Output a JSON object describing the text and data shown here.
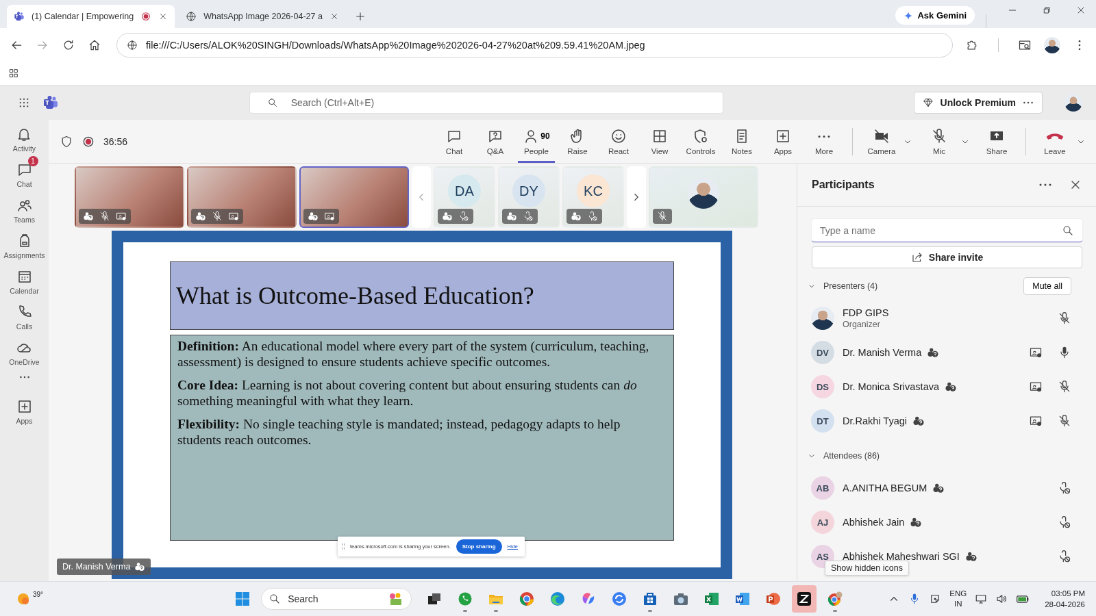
{
  "browser": {
    "tabs": [
      {
        "title": "(1) Calendar | Empowering",
        "recording": true,
        "selected": true
      },
      {
        "title": "WhatsApp Image 2026-04-27 a",
        "recording": false,
        "selected": false
      }
    ],
    "ask_gemini": "Ask Gemini",
    "url": "file:///C:/Users/ALOK%20SINGH/Downloads/WhatsApp%20Image%202026-04-27%20at%209.59.41%20AM.jpeg"
  },
  "header": {
    "search": {
      "placeholder": "Search (Ctrl+Alt+E)"
    },
    "premium": "Unlock Premium"
  },
  "rail": [
    {
      "kind": "activity",
      "label": "Activity"
    },
    {
      "kind": "chat",
      "label": "Chat",
      "badge": "1"
    },
    {
      "kind": "teams",
      "label": "Teams"
    },
    {
      "kind": "assignments",
      "label": "Assignments"
    },
    {
      "kind": "calendar",
      "label": "Calendar"
    },
    {
      "kind": "calls",
      "label": "Calls"
    },
    {
      "kind": "onedrive",
      "label": "OneDrive"
    },
    {
      "kind": "more"
    },
    {
      "kind": "apps",
      "label": "Apps"
    }
  ],
  "meeting": {
    "timer": "36:56",
    "recording": true,
    "actions": [
      {
        "kind": "chat",
        "label": "Chat",
        "selected": false
      },
      {
        "kind": "qa",
        "label": "Q&A",
        "selected": false
      },
      {
        "kind": "people",
        "label": "People",
        "count": "90",
        "selected": true
      },
      {
        "kind": "raise",
        "label": "Raise",
        "selected": false
      },
      {
        "kind": "react",
        "label": "React",
        "selected": false
      },
      {
        "kind": "view",
        "label": "View",
        "selected": false
      },
      {
        "kind": "controls",
        "label": "Controls",
        "selected": false
      },
      {
        "kind": "notes",
        "label": "Notes",
        "selected": false
      },
      {
        "kind": "apps",
        "label": "Apps",
        "selected": false
      },
      {
        "kind": "more",
        "label": "More",
        "selected": false
      }
    ],
    "devices": [
      {
        "kind": "camera",
        "label": "Camera",
        "caret": true
      },
      {
        "kind": "mic",
        "label": "Mic",
        "caret": true
      },
      {
        "kind": "share",
        "label": "Share",
        "caret": false
      },
      {
        "kind": "leave",
        "label": "Leave",
        "caret": true
      }
    ],
    "tiles": [
      {
        "kind": "video",
        "muted": true,
        "screen": true,
        "speaking": false
      },
      {
        "kind": "video",
        "muted": true,
        "screen": true,
        "speaking": false
      },
      {
        "kind": "video",
        "screen": true,
        "speaking": true
      },
      {
        "kind": "prev"
      },
      {
        "kind": "initials",
        "initials": "DA",
        "color": "#d6e9ee",
        "mic_blocked": true,
        "speaking": false
      },
      {
        "kind": "initials",
        "initials": "DY",
        "color": "#d8e4ef",
        "mic_blocked": true,
        "speaking": false
      },
      {
        "kind": "initials",
        "initials": "KC",
        "color": "#fbe5d3",
        "mic_blocked": true,
        "speaking": false
      },
      {
        "kind": "next"
      },
      {
        "kind": "photo",
        "muted": true,
        "speaking": false
      }
    ],
    "slide": {
      "title": "What is Outcome-Based Education?",
      "paragraphs": [
        "**Definition:** An educational model where every part of the system (curriculum, teaching, assessment) is designed to ensure students achieve specific outcomes.",
        "**Core Idea:** Learning is not about covering content but about ensuring students can *do* something meaningful with what they learn.",
        "**Flexibility:** No single teaching style is mandated; instead, pedagogy adapts to help students reach outcomes."
      ]
    },
    "share_bar": {
      "message": "teams.microsoft.com is sharing your screen.",
      "stop": "Stop sharing",
      "hide": "Hide"
    },
    "presenter": "Dr. Manish Verma"
  },
  "participants": {
    "title": "Participants",
    "search": {
      "placeholder": "Type a name"
    },
    "share_invite": "Share invite",
    "groups": [
      {
        "label": "Presenters (4)",
        "expanded": true,
        "action": "Mute all",
        "people": [
          {
            "photo": true,
            "name": "FDP GIPS",
            "subtitle": "Organizer",
            "muted": true
          },
          {
            "initials": "DV",
            "color": "#d5dde4",
            "name": "Dr. Manish Verma",
            "badge": true,
            "screen": true,
            "muted": false
          },
          {
            "initials": "DS",
            "color": "#f6d7e1",
            "name": "Dr. Monica Srivastava",
            "badge": true,
            "screen": true,
            "muted": true
          },
          {
            "initials": "DT",
            "color": "#d3e0f0",
            "name": "Dr.Rakhi Tyagi",
            "badge": true,
            "screen": true,
            "muted": true
          }
        ]
      },
      {
        "label": "Attendees (86)",
        "expanded": true,
        "people": [
          {
            "initials": "AB",
            "color": "#ead3e4",
            "name": "A.ANITHA BEGUM",
            "badge": true,
            "mic_blocked": true
          },
          {
            "initials": "AJ",
            "color": "#f4d5db",
            "name": "Abhishek Jain",
            "badge": true,
            "mic_blocked": true
          },
          {
            "initials": "AS",
            "color": "#ead3e4",
            "name": "Abhishek Maheshwari SGI",
            "badge": true,
            "mic_blocked": true
          }
        ]
      }
    ]
  },
  "tooltip": "Show hidden icons",
  "taskbar": {
    "weather": "39°",
    "search": "Search",
    "apps": [
      {
        "kind": "taskview",
        "running": false,
        "highlighted": false
      },
      {
        "kind": "phonechat",
        "running": true,
        "highlighted": false
      },
      {
        "kind": "folder",
        "running": true,
        "highlighted": false
      },
      {
        "kind": "ring",
        "running": false,
        "highlighted": false
      },
      {
        "kind": "wave",
        "running": false,
        "highlighted": false
      },
      {
        "kind": "swirl",
        "running": false,
        "highlighted": false
      },
      {
        "kind": "sync",
        "running": false,
        "highlighted": false
      },
      {
        "kind": "bag",
        "running": true,
        "highlighted": false
      },
      {
        "kind": "camera",
        "running": false,
        "highlighted": false
      },
      {
        "kind": "sheet",
        "running": false,
        "highlighted": false
      },
      {
        "kind": "doc",
        "running": false,
        "highlighted": false
      },
      {
        "kind": "slides",
        "running": false,
        "highlighted": false
      },
      {
        "kind": "cut",
        "running": false,
        "highlighted": true
      },
      {
        "kind": "ringprofile",
        "running": true,
        "highlighted": false
      }
    ],
    "lang": "ENG",
    "region": "IN",
    "time": "03:05 PM",
    "date": "28-04-2026"
  }
}
